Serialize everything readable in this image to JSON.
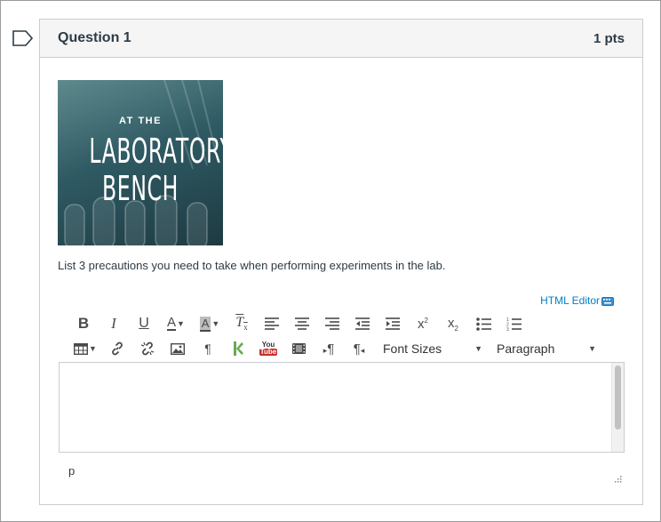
{
  "question": {
    "title": "Question 1",
    "points": "1 pts",
    "image_text": {
      "line1": "AT THE",
      "line2": "LABORATORY",
      "line3": "BENCH"
    },
    "prompt": "List 3 precautions you need to take when performing experiments in the lab."
  },
  "editor": {
    "html_editor_link": "HTML Editor",
    "toolbar_row1": [
      {
        "name": "bold-button",
        "icon": "bold-icon"
      },
      {
        "name": "italic-button",
        "icon": "italic-icon"
      },
      {
        "name": "underline-button",
        "icon": "underline-icon"
      },
      {
        "name": "text-color-button",
        "icon": "text-color-icon"
      },
      {
        "name": "background-color-button",
        "icon": "background-color-icon"
      },
      {
        "name": "clear-formatting-button",
        "icon": "clear-formatting-icon"
      },
      {
        "name": "align-left-button",
        "icon": "align-left-icon"
      },
      {
        "name": "align-center-button",
        "icon": "align-center-icon"
      },
      {
        "name": "align-right-button",
        "icon": "align-right-icon"
      },
      {
        "name": "outdent-button",
        "icon": "outdent-icon"
      },
      {
        "name": "indent-button",
        "icon": "indent-icon"
      },
      {
        "name": "superscript-button",
        "icon": "superscript-icon"
      },
      {
        "name": "subscript-button",
        "icon": "subscript-icon"
      },
      {
        "name": "bullet-list-button",
        "icon": "bullet-list-icon"
      },
      {
        "name": "numbered-list-button",
        "icon": "numbered-list-icon"
      }
    ],
    "toolbar_row2": [
      {
        "name": "table-button",
        "icon": "table-icon"
      },
      {
        "name": "link-button",
        "icon": "link-icon"
      },
      {
        "name": "unlink-button",
        "icon": "unlink-icon"
      },
      {
        "name": "image-button",
        "icon": "image-icon"
      },
      {
        "name": "paragraph-mark-button",
        "icon": "pilcrow-icon"
      },
      {
        "name": "kaltura-button",
        "icon": "kaltura-icon"
      },
      {
        "name": "youtube-button",
        "icon": "youtube-icon"
      },
      {
        "name": "media-button",
        "icon": "film-icon"
      },
      {
        "name": "ltr-button",
        "icon": "ltr-icon"
      },
      {
        "name": "rtl-button",
        "icon": "rtl-icon"
      }
    ],
    "font_sizes_label": "Font Sizes",
    "paragraph_label": "Paragraph",
    "youtube_text": {
      "top": "You",
      "bottom": "Tube"
    },
    "superscript_sample": {
      "base": "x",
      "sup": "2"
    },
    "subscript_sample": {
      "base": "x",
      "sub": "2"
    },
    "body_text": "",
    "path_label": "p"
  },
  "colors": {
    "link": "#0081c6",
    "header_bg": "#f5f5f5",
    "border": "#c7cdd1",
    "kaltura_green": "#6aa84f",
    "youtube_red": "#c4302b"
  }
}
